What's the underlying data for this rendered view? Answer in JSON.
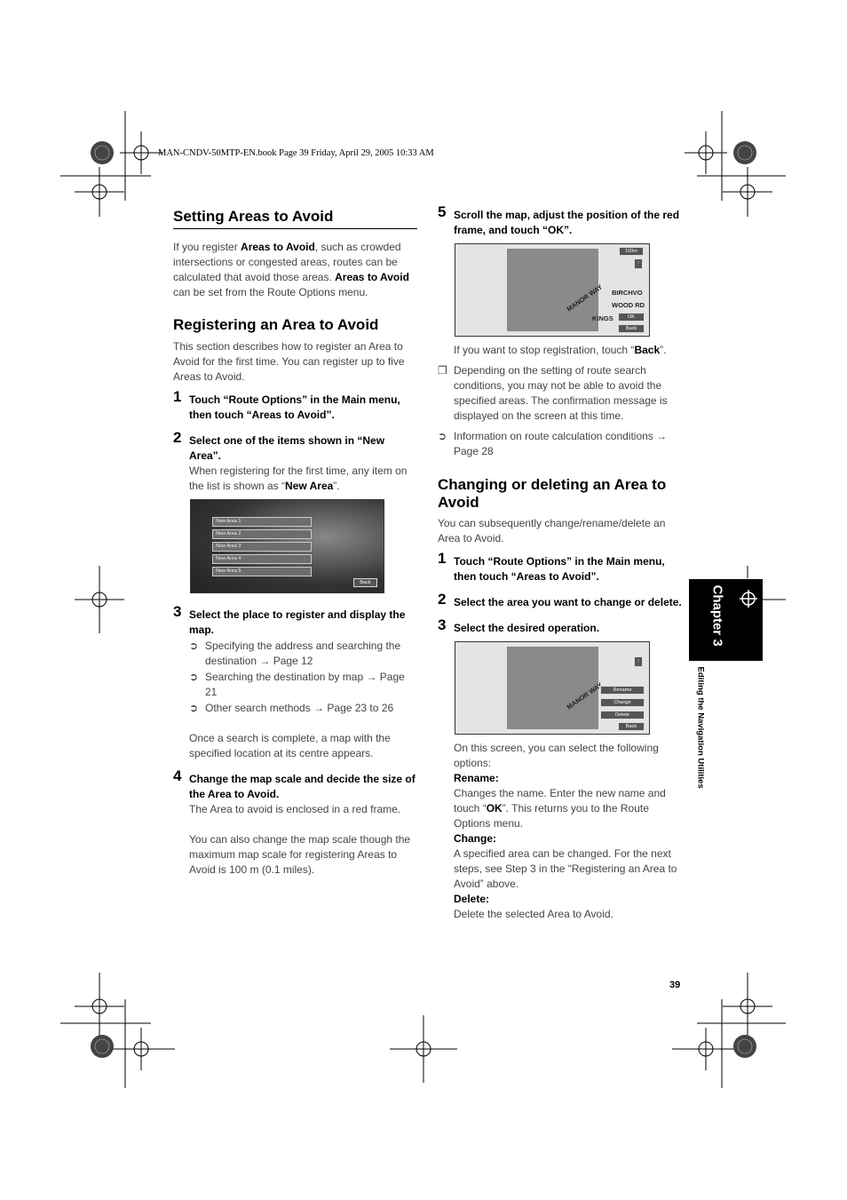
{
  "header": {
    "text": "MAN-CNDV-50MTP-EN.book  Page 39  Friday, April 29, 2005  10:33 AM"
  },
  "left": {
    "h1": "Setting Areas to Avoid",
    "intro": [
      "If you register ",
      "Areas to Avoid",
      ", such as crowded intersections or congested areas, routes can be calculated that avoid those areas. ",
      "Areas to Avoid",
      " can be set from the Route Options menu."
    ],
    "h2": "Registering an Area to Avoid",
    "p2": "This section describes how to register an Area to Avoid for the first time. You can register up to five Areas to Avoid.",
    "s1": {
      "n": "1",
      "text": "Touch “Route Options” in the Main menu, then touch “Areas to Avoid”."
    },
    "s2": {
      "n": "2",
      "text": "Select one of the items shown in “New Area”.",
      "desc_a": "When registering for the first time, any item on the list is shown as “",
      "desc_b": "New Area",
      "desc_c": "”."
    },
    "screen1": {
      "items": [
        "New Area 1",
        "New Area 2",
        "New Area 3",
        "New Area 4",
        "New Area 5"
      ],
      "back": "Back"
    },
    "s3": {
      "n": "3",
      "text": "Select the place to register and display the map.",
      "bullets": [
        "Specifying the address and searching the destination → Page 12",
        "Searching the destination by map → Page 21",
        "Other search methods → Page 23 to 26"
      ],
      "desc": "Once a search is complete, a map with the specified location at its centre appears."
    },
    "s4": {
      "n": "4",
      "text": "Change the map scale and decide the size of the Area to Avoid.",
      "desc1": "The Area to avoid is enclosed in a red frame.",
      "desc2": "You can also change the map scale though the maximum map scale for registering Areas to Avoid is 100 m (0.1 miles)."
    }
  },
  "right": {
    "s5": {
      "n": "5",
      "text": "Scroll the map, adjust the position of the red frame, and touch “OK”."
    },
    "screen2": {
      "scale": "100m",
      "ok": "OK",
      "back": "Back",
      "labels": [
        "BIRCHVO",
        "WOOD RD",
        "KINGS",
        "MANOR WAY"
      ]
    },
    "stop_a": "If you want to stop registration, touch “",
    "stop_b": "Back",
    "stop_c": "”.",
    "note": "Depending on the setting of route search conditions, you may not be able to avoid the specified areas. The confirmation message is displayed on the screen at this time.",
    "ref": "Information on route calculation conditions → Page 28",
    "h3": "Changing or deleting an Area to Avoid",
    "p3": "You can subsequently change/rename/delete an Area to Avoid.",
    "c1": {
      "n": "1",
      "text": "Touch “Route Options” in the Main menu, then touch “Areas to Avoid”."
    },
    "c2": {
      "n": "2",
      "text": "Select the area you want to change or delete."
    },
    "c3": {
      "n": "3",
      "text": "Select the desired operation."
    },
    "screen3": {
      "buttons": [
        "Rename",
        "Change",
        "Delete"
      ],
      "back": "Back",
      "label": "MANOR WAY"
    },
    "opts": "On this screen, you can select the following options:",
    "rename_h": "Rename:",
    "rename_a": "Changes the name. Enter the new name and touch “",
    "rename_b": "OK",
    "rename_c": "”. This returns you to the Route Options menu.",
    "change_h": "Change:",
    "change": "A specified area can be changed. For the next steps, see Step 3 in the “Registering an Area to Avoid” above.",
    "delete_h": "Delete:",
    "delete": "Delete the selected Area to Avoid."
  },
  "side": {
    "chapter": "Chapter 3",
    "section": "Editing the Navigation Utilities"
  },
  "page_number": "39"
}
